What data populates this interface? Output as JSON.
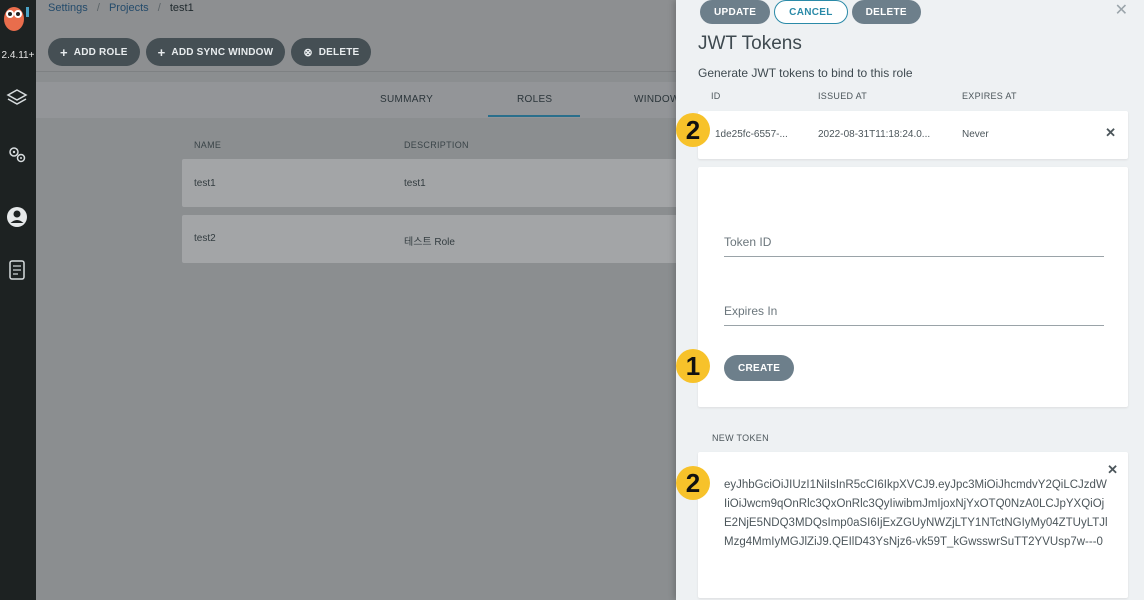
{
  "sidebar": {
    "version": "2.4.11+",
    "icons": [
      "argo-logo-icon",
      "layers-icon",
      "gears-icon",
      "user-icon",
      "docs-icon"
    ]
  },
  "breadcrumb": {
    "items": [
      "Settings",
      "Projects",
      "test1"
    ]
  },
  "toolbar": {
    "add_role": "ADD ROLE",
    "add_sync_window": "ADD SYNC WINDOW",
    "delete": "DELETE"
  },
  "tabs": [
    "SUMMARY",
    "ROLES",
    "WINDOW"
  ],
  "roles_table": {
    "headers": [
      "NAME",
      "DESCRIPTION"
    ],
    "rows": [
      {
        "name": "test1",
        "description": "test1"
      },
      {
        "name": "test2",
        "description": "테스트 Role"
      }
    ]
  },
  "panel": {
    "buttons": {
      "update": "UPDATE",
      "cancel": "CANCEL",
      "delete": "DELETE"
    },
    "close": "✕",
    "title": "JWT Tokens",
    "subtitle": "Generate JWT tokens to bind to this role",
    "tokens_table": {
      "headers": [
        "ID",
        "ISSUED AT",
        "EXPIRES AT"
      ],
      "rows": [
        {
          "id": "1de25fc-6557-...",
          "issued_at": "2022-08-31T11:18:24.0...",
          "expires_at": "Never"
        }
      ]
    },
    "form": {
      "token_id_placeholder": "Token ID",
      "expires_in_placeholder": "Expires In",
      "create": "CREATE"
    },
    "new_token": {
      "label": "NEW TOKEN",
      "value": "eyJhbGciOiJIUzI1NiIsInR5cCI6IkpXVCJ9.eyJpc3MiOiJhcmdvY2QiLCJzdWIiOiJwcm9qOnRlc3QxOnRlc3QyIiwibmJmIjoxNjYxOTQ0NzA0LCJpYXQiOjE2NjE5NDQ3MDQsImp0aSI6IjExZGUyNWZjLTY1NTctNGIyMy04ZTUyLTJlMzg4MmIyMGJlZiJ9.QEIlD43YsNjz6-vk59T_kGwsswrSuTT2YVUsp7w---0"
    }
  },
  "annotations": {
    "badge_1": "1",
    "badge_2": "2"
  },
  "colors": {
    "accent": "#2a8aa8",
    "badge": "#f7c22a",
    "button_dark": "#6d7f8b"
  }
}
